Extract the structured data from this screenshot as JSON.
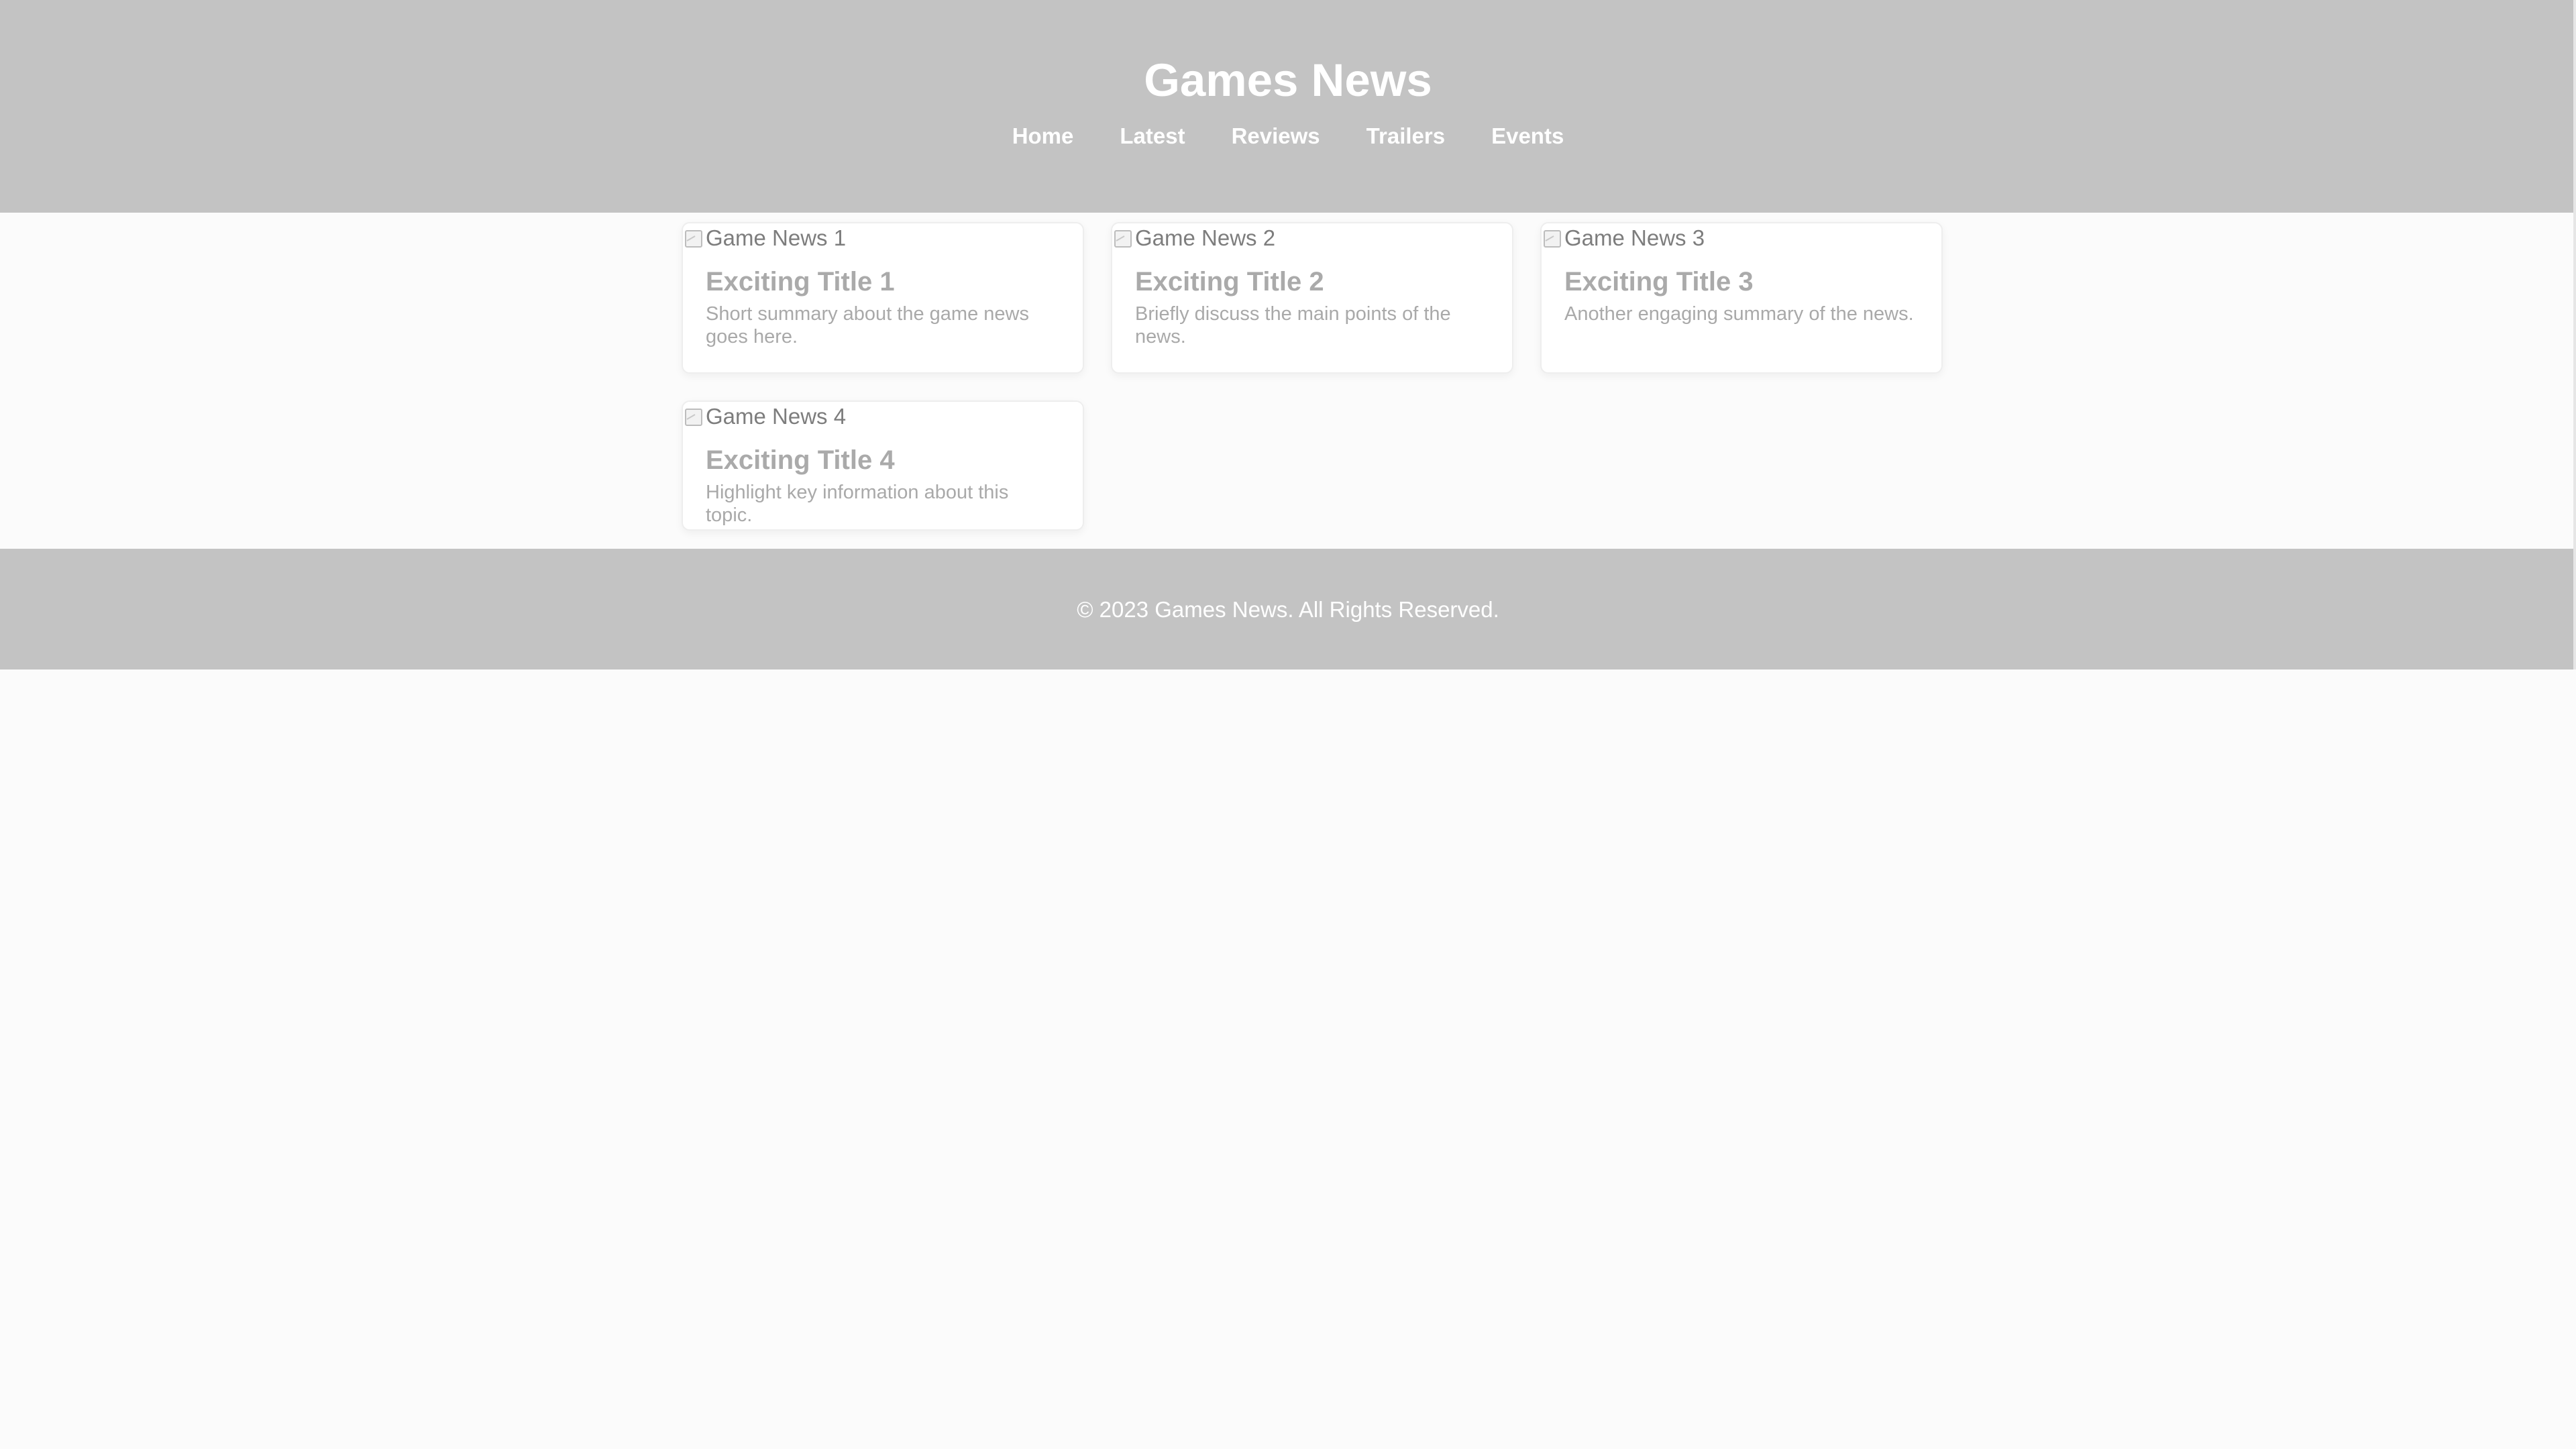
{
  "header": {
    "title": "Games News",
    "nav": [
      "Home",
      "Latest",
      "Reviews",
      "Trailers",
      "Events"
    ]
  },
  "cards": [
    {
      "image_alt": "Game News 1",
      "title": "Exciting Title 1",
      "summary": "Short summary about the game news goes here."
    },
    {
      "image_alt": "Game News 2",
      "title": "Exciting Title 2",
      "summary": "Briefly discuss the main points of the news."
    },
    {
      "image_alt": "Game News 3",
      "title": "Exciting Title 3",
      "summary": "Another engaging summary of the news."
    },
    {
      "image_alt": "Game News 4",
      "title": "Exciting Title 4",
      "summary": "Highlight key information about this topic."
    }
  ],
  "footer": {
    "text": "© 2023 Games News. All Rights Reserved."
  },
  "colors": {
    "header_bg": "#c3c3c3",
    "page_bg": "#fbfbfb",
    "card_bg": "#ffffff",
    "card_title": "#aaaaaa",
    "card_text": "#a9a9a9"
  },
  "icons": {
    "image_placeholder": "broken-image-icon"
  }
}
